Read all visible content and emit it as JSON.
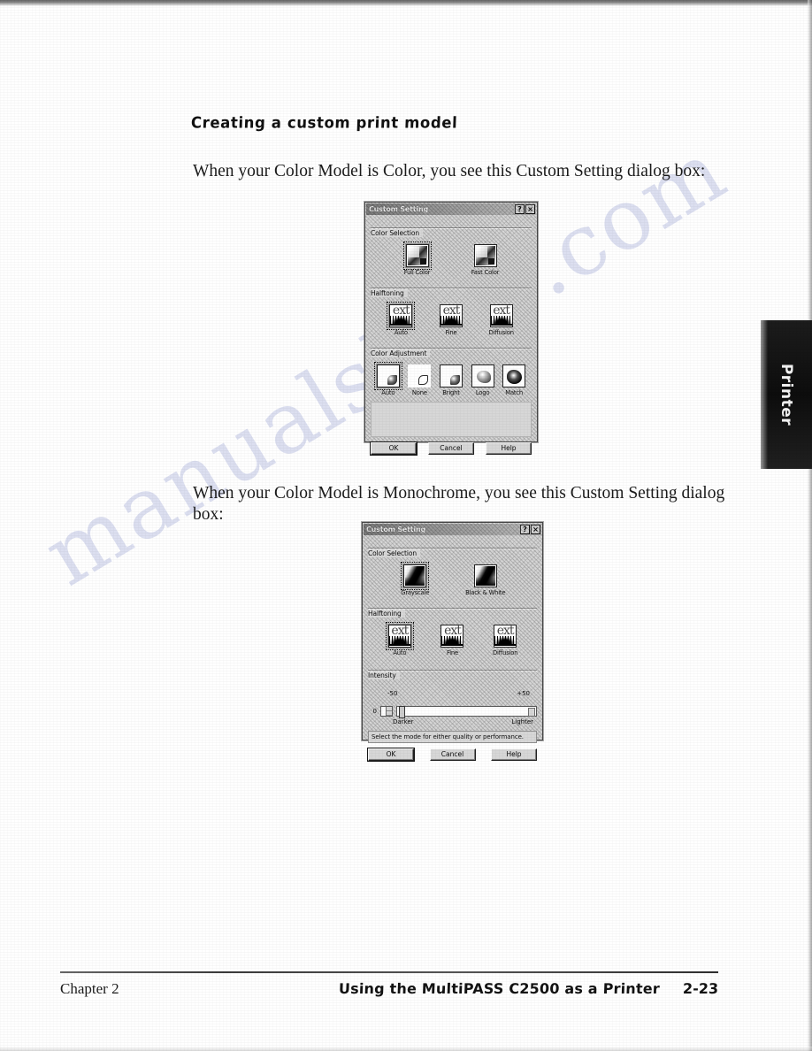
{
  "page": {
    "heading": "Creating a custom print model",
    "paragraph_color": "When your Color Model is Color, you see this Custom Setting dialog box:",
    "paragraph_mono": "When your Color Model is Monochrome, you see this Custom Setting dialog box:",
    "watermark": "manualshive.com",
    "thumb_tab": "Printer"
  },
  "footer": {
    "chapter": "Chapter 2",
    "title": "Using the MultiPASS C2500 as a Printer",
    "page_number": "2-23"
  },
  "dialog_color": {
    "title": "Custom Setting",
    "help_btn": "?",
    "close_btn": "×",
    "groups": {
      "color_selection": {
        "label": "Color Selection",
        "options": [
          {
            "caption": "Full Color",
            "icon": "color-swatch-icon",
            "selected": true
          },
          {
            "caption": "Fast Color",
            "icon": "color-swatch-icon",
            "selected": false
          }
        ]
      },
      "halftoning": {
        "label": "Halftoning",
        "options": [
          {
            "caption": "Auto",
            "icon": "halftone-ext-icon",
            "glyph": "ext",
            "selected": true
          },
          {
            "caption": "Fine",
            "icon": "halftone-ext-icon",
            "glyph": "ext",
            "selected": false
          },
          {
            "caption": "Diffusion",
            "icon": "halftone-ext-icon",
            "glyph": "ext",
            "selected": false
          }
        ]
      },
      "color_adjustment": {
        "label": "Color Adjustment",
        "options": [
          {
            "caption": "Auto",
            "icon": "adjust-auto-icon",
            "selected": true
          },
          {
            "caption": "None",
            "icon": "adjust-none-icon",
            "selected": false
          },
          {
            "caption": "Bright",
            "icon": "adjust-bright-icon",
            "selected": false
          },
          {
            "caption": "Logo",
            "icon": "adjust-logo-icon",
            "selected": false
          },
          {
            "caption": "Match",
            "icon": "adjust-match-icon",
            "selected": false
          }
        ]
      }
    },
    "status_text": "",
    "buttons": [
      {
        "label": "OK",
        "name": "ok-button",
        "default": true
      },
      {
        "label": "Cancel",
        "name": "cancel-button",
        "default": false
      },
      {
        "label": "Help",
        "name": "help-button",
        "default": false
      }
    ]
  },
  "dialog_mono": {
    "title": "Custom Setting",
    "help_btn": "?",
    "close_btn": "×",
    "groups": {
      "color_selection": {
        "label": "Color Selection",
        "options": [
          {
            "caption": "Grayscale",
            "icon": "gray-swatch-icon",
            "selected": true
          },
          {
            "caption": "Black & White",
            "icon": "gray-swatch-icon",
            "selected": false
          }
        ]
      },
      "halftoning": {
        "label": "Halftoning",
        "options": [
          {
            "caption": "Auto",
            "icon": "halftone-ext-icon",
            "glyph": "ext",
            "selected": true
          },
          {
            "caption": "Fine",
            "icon": "halftone-ext-icon",
            "glyph": "ext",
            "selected": false
          },
          {
            "caption": "Diffusion",
            "icon": "halftone-ext-icon",
            "glyph": "ext",
            "selected": false
          }
        ]
      },
      "intensity": {
        "label": "Intensity",
        "value": "0",
        "min_label": "-50",
        "max_label": "+50",
        "left_caption": "Darker",
        "right_caption": "Lighter"
      }
    },
    "status_text": "Select the mode for either quality or performance.",
    "buttons": [
      {
        "label": "OK",
        "name": "ok-button",
        "default": true
      },
      {
        "label": "Cancel",
        "name": "cancel-button",
        "default": false
      },
      {
        "label": "Help",
        "name": "help-button",
        "default": false
      }
    ]
  }
}
